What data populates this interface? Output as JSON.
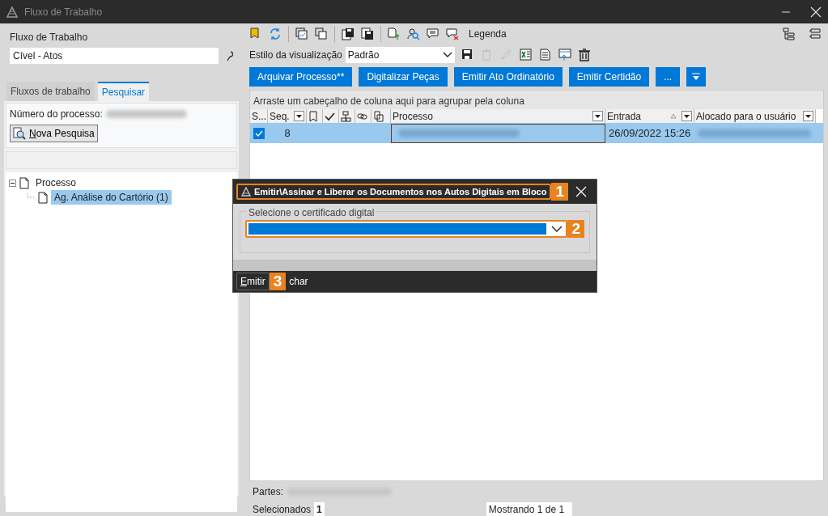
{
  "window": {
    "title": "Fluxo de Trabalho"
  },
  "left_panel": {
    "workflow_label": "Fluxo de Trabalho",
    "workflow_value": "Cível - Atos",
    "tabs": [
      {
        "label": "Fluxos de trabalho",
        "selected": false
      },
      {
        "label": "Pesquisar",
        "selected": true
      }
    ],
    "process_number_label": "Número do processo:",
    "search_button": "Nova Pesquisa",
    "tree": [
      {
        "label": "Processo",
        "expanded": true,
        "selected": false,
        "children": [
          {
            "label": "Ag. Análise do Cartório (1)",
            "selected": true
          }
        ]
      }
    ]
  },
  "toolbar": {
    "legend_label": "Legenda",
    "view_style_label": "Estilo da visualização",
    "view_style_value": "Padrão"
  },
  "action_buttons": [
    "Arquivar Processo**",
    "Digitalizar Peças",
    "Emitir Ato Ordinatório",
    "Emitir Certidão",
    "..."
  ],
  "grid": {
    "group_hint": "Arraste um cabeçalho de coluna aqui para agrupar pela coluna",
    "columns": [
      {
        "kind": "text",
        "label": "S...",
        "filter": false
      },
      {
        "kind": "text",
        "label": "Seq.",
        "filter": true
      },
      {
        "kind": "bookmark"
      },
      {
        "kind": "check"
      },
      {
        "kind": "tree"
      },
      {
        "kind": "link"
      },
      {
        "kind": "document"
      },
      {
        "kind": "text",
        "label": "Processo",
        "filter": true
      },
      {
        "kind": "text",
        "label": "Entrada",
        "filter": true,
        "sorted": true
      },
      {
        "kind": "text",
        "label": "Alocado para o usuário",
        "filter": true
      }
    ],
    "rows": [
      {
        "checked": true,
        "selected": true,
        "seq": "8",
        "entrada": "26/09/2022 15:26"
      }
    ]
  },
  "footer": {
    "parts_label": "Partes:",
    "selected_label": "Selecionados",
    "selected_count": "1",
    "showing": "Mostrando 1 de 1"
  },
  "dialog": {
    "title": "Emitir\\Assinar e Liberar os Documentos nos Autos Digitais em Bloco",
    "group_label": "Selecione o certificado digital",
    "button": "Emitir",
    "partial_text": "char",
    "callouts": [
      "1",
      "2",
      "3"
    ]
  }
}
